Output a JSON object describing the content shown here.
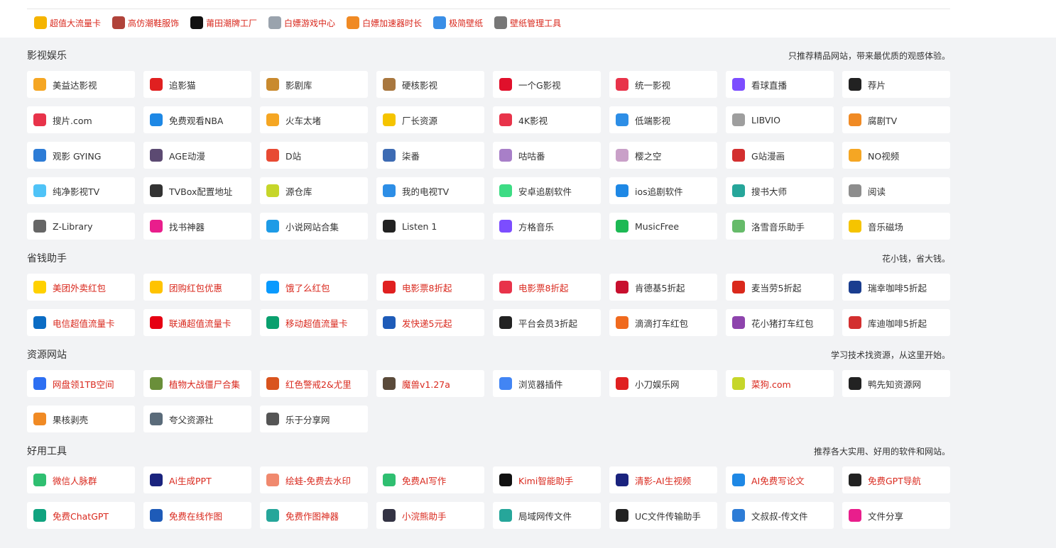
{
  "topbar": {
    "links": [
      {
        "label": "超值大流量卡",
        "icon": "sim-card-icon",
        "color": "#f5b400"
      },
      {
        "label": "高仿潮鞋服饰",
        "icon": "sneaker-icon",
        "color": "#b0433a"
      },
      {
        "label": "莆田潮牌工厂",
        "icon": "brand-logo-icon",
        "color": "#111111"
      },
      {
        "label": "白嫖游戏中心",
        "icon": "gamepad-icon",
        "color": "#9aa3ad"
      },
      {
        "label": "白嫖加速器时长",
        "icon": "rocket-icon",
        "color": "#f08a24"
      },
      {
        "label": "极简壁纸",
        "icon": "color-wheel-icon",
        "color": "#3a8ee6"
      },
      {
        "label": "壁纸管理工具",
        "icon": "wallpaper-logo-icon",
        "color": "#777777"
      }
    ]
  },
  "sections": [
    {
      "title": "影视娱乐",
      "desc": "只推荐精品网站，带来最优质的观感体验。",
      "items": [
        {
          "label": "美益达影视",
          "color": "#f5a623"
        },
        {
          "label": "追影猫",
          "color": "#e02020"
        },
        {
          "label": "影剧库",
          "color": "#c98a2e"
        },
        {
          "label": "硬核影视",
          "color": "#a8773f"
        },
        {
          "label": "一个G影视",
          "color": "#e0102b"
        },
        {
          "label": "统一影视",
          "color": "#e8334a"
        },
        {
          "label": "看球直播",
          "color": "#7c4dff"
        },
        {
          "label": "荐片",
          "color": "#222222"
        },
        {
          "label": "搜片.com",
          "color": "#e8334a"
        },
        {
          "label": "免费观看NBA",
          "color": "#1e88e5"
        },
        {
          "label": "火车太堵",
          "color": "#f5a623"
        },
        {
          "label": "厂长资源",
          "color": "#f5c400"
        },
        {
          "label": "4K影视",
          "color": "#e8334a"
        },
        {
          "label": "低端影视",
          "color": "#2d8ee6"
        },
        {
          "label": "LIBVIO",
          "color": "#9e9e9e"
        },
        {
          "label": "腐剧TV",
          "color": "#f08a24"
        },
        {
          "label": "观影 GYING",
          "color": "#2d7cd6"
        },
        {
          "label": "AGE动漫",
          "color": "#5c4a72"
        },
        {
          "label": "D站",
          "color": "#e84a33"
        },
        {
          "label": "柒番",
          "color": "#3d6bb3"
        },
        {
          "label": "咕咕番",
          "color": "#a87fc8"
        },
        {
          "label": "樱之空",
          "color": "#c9a0c8"
        },
        {
          "label": "G站漫画",
          "color": "#d32f2f"
        },
        {
          "label": "NO视频",
          "color": "#f5a623"
        },
        {
          "label": "纯净影视TV",
          "color": "#4fc3f7"
        },
        {
          "label": "TVBox配置地址",
          "color": "#333333"
        },
        {
          "label": "源仓库",
          "color": "#c6d62a"
        },
        {
          "label": "我的电视TV",
          "color": "#2d8ee6"
        },
        {
          "label": "安卓追剧软件",
          "color": "#3ddc84"
        },
        {
          "label": "ios追剧软件",
          "color": "#1e88e5"
        },
        {
          "label": "搜书大师",
          "color": "#26a69a"
        },
        {
          "label": "阅读",
          "color": "#8d8d8d"
        },
        {
          "label": "Z-Library",
          "color": "#666666"
        },
        {
          "label": "找书神器",
          "color": "#e91e8c"
        },
        {
          "label": "小说网站合集",
          "color": "#1e9be6"
        },
        {
          "label": "Listen 1",
          "color": "#222222"
        },
        {
          "label": "方格音乐",
          "color": "#7c4dff"
        },
        {
          "label": "MusicFree",
          "color": "#1db954"
        },
        {
          "label": "洛雪音乐助手",
          "color": "#66bb6a"
        },
        {
          "label": "音乐磁场",
          "color": "#f5c400"
        }
      ]
    },
    {
      "title": "省钱助手",
      "desc": "花小钱，省大钱。",
      "items": [
        {
          "label": "美团外卖红包",
          "color": "#ffd100",
          "red": true
        },
        {
          "label": "团购红包优惠",
          "color": "#ffc300",
          "red": true
        },
        {
          "label": "饿了么红包",
          "color": "#0a9afe",
          "red": true
        },
        {
          "label": "电影票8折起",
          "color": "#e02020",
          "red": true
        },
        {
          "label": "电影票8折起",
          "color": "#e8334a",
          "red": true
        },
        {
          "label": "肯德基5折起",
          "color": "#c8102e",
          "red": false
        },
        {
          "label": "麦当劳5折起",
          "color": "#da291c",
          "red": false
        },
        {
          "label": "瑞幸咖啡5折起",
          "color": "#1a3d8f",
          "red": false
        },
        {
          "label": "电信超值流量卡",
          "color": "#0b6cc4",
          "red": true
        },
        {
          "label": "联通超值流量卡",
          "color": "#e60012",
          "red": true
        },
        {
          "label": "移动超值流量卡",
          "color": "#0aa06e",
          "red": true
        },
        {
          "label": "发快递5元起",
          "color": "#1e5bb8",
          "red": true
        },
        {
          "label": "平台会员3折起",
          "color": "#222222",
          "red": false
        },
        {
          "label": "滴滴打车红包",
          "color": "#f06a1e",
          "red": false
        },
        {
          "label": "花小猪打车红包",
          "color": "#8e44ad",
          "red": false
        },
        {
          "label": "库迪咖啡5折起",
          "color": "#d32f2f",
          "red": false
        }
      ]
    },
    {
      "title": "资源网站",
      "desc": "学习技术找资源，从这里开始。",
      "items": [
        {
          "label": "网盘领1TB空间",
          "color": "#2d6ff2",
          "red": true
        },
        {
          "label": "植物大战僵尸合集",
          "color": "#6a8f3a",
          "red": true
        },
        {
          "label": "红色警戒2&尤里",
          "color": "#d9541e",
          "red": true
        },
        {
          "label": "魔兽v1.27a",
          "color": "#5a4a3a",
          "red": true
        },
        {
          "label": "浏览器插件",
          "color": "#4285f4",
          "red": false
        },
        {
          "label": "小刀娱乐网",
          "color": "#e02020",
          "red": false
        },
        {
          "label": "菜狗.com",
          "color": "#c6d62a",
          "red": true
        },
        {
          "label": "鸭先知资源网",
          "color": "#222222",
          "red": false
        },
        {
          "label": "果核剥壳",
          "color": "#f08a24",
          "red": false
        },
        {
          "label": "夸父资源社",
          "color": "#5a6b7a",
          "red": false
        },
        {
          "label": "乐于分享网",
          "color": "#555555",
          "red": false
        }
      ]
    },
    {
      "title": "好用工具",
      "desc": "推荐各大实用、好用的软件和网站。",
      "items": [
        {
          "label": "微信人脉群",
          "color": "#2fbf71",
          "red": true
        },
        {
          "label": "Ai生成PPT",
          "color": "#1a237e",
          "red": true
        },
        {
          "label": "绘蛙-免费去水印",
          "color": "#f0896e",
          "red": true
        },
        {
          "label": "免费AI写作",
          "color": "#2fbf71",
          "red": true
        },
        {
          "label": "Kimi智能助手",
          "color": "#111111",
          "red": true
        },
        {
          "label": "清影-AI生视频",
          "color": "#1a237e",
          "red": true
        },
        {
          "label": "AI免费写论文",
          "color": "#1e88e5",
          "red": true
        },
        {
          "label": "免费GPT导航",
          "color": "#222222",
          "red": true
        },
        {
          "label": "免费ChatGPT",
          "color": "#10a37f",
          "red": true
        },
        {
          "label": "免费在线作图",
          "color": "#1e5bb8",
          "red": true
        },
        {
          "label": "免费作图神器",
          "color": "#26a69a",
          "red": true
        },
        {
          "label": "小浣熊助手",
          "color": "#333344",
          "red": true
        },
        {
          "label": "局域网传文件",
          "color": "#26a69a",
          "red": false
        },
        {
          "label": "UC文件传输助手",
          "color": "#222222",
          "red": false
        },
        {
          "label": "文叔叔-传文件",
          "color": "#2d7cd6",
          "red": false
        },
        {
          "label": "文件分享",
          "color": "#e91e8c",
          "red": false
        }
      ]
    }
  ]
}
